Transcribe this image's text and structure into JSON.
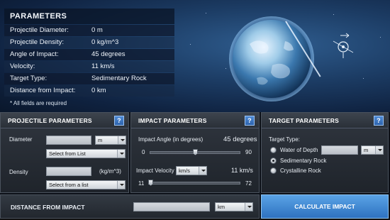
{
  "parameters": {
    "title": "PARAMETERS",
    "rows": [
      {
        "label": "Projectile Diameter:",
        "value": "0 m"
      },
      {
        "label": "Projectile Density:",
        "value": "0 kg/m^3"
      },
      {
        "label": "Angle of Impact:",
        "value": "45 degrees"
      },
      {
        "label": "Velocity:",
        "value": "11 km/s"
      },
      {
        "label": "Target Type:",
        "value": "Sedimentary Rock"
      },
      {
        "label": "Distance from Impact:",
        "value": "0 km"
      }
    ],
    "required_note": "* All fields are required"
  },
  "projectile": {
    "title": "PROJECTILE PARAMETERS",
    "help": "?",
    "diameter_label": "Diameter",
    "diameter_value": "",
    "diameter_unit": "m",
    "diameter_list": "Select from List",
    "density_label": "Density",
    "density_value": "",
    "density_unit": "(kg/m^3)",
    "density_list": "Select from a list"
  },
  "impact": {
    "title": "IMPACT PARAMETERS",
    "help": "?",
    "angle_label": "Impact Angle (in degrees)",
    "angle_value": "45 degrees",
    "angle_min": "0",
    "angle_max": "90",
    "angle_fraction": 0.5,
    "velocity_label": "Impact Velocity",
    "velocity_unit": "km/s",
    "velocity_value": "11 km/s",
    "velocity_min": "11",
    "velocity_max": "72",
    "velocity_fraction": 0.0
  },
  "target": {
    "title": "TARGET PARAMETERS",
    "help": "?",
    "type_label": "Target Type:",
    "options": [
      {
        "label": "Water of Depth",
        "selected": false
      },
      {
        "label": "Sedimentary Rock",
        "selected": true
      },
      {
        "label": "Crystalline Rock",
        "selected": false
      }
    ],
    "water_depth_value": "",
    "water_depth_unit": "m"
  },
  "distance": {
    "label": "DISTANCE FROM IMPACT",
    "value": "",
    "unit": "km"
  },
  "calculate_label": "CALCULATE IMPACT",
  "colors": {
    "accent_blue": "#3f88d2",
    "panel_bg": "#2a3038",
    "space_blue": "#1c3c64"
  }
}
